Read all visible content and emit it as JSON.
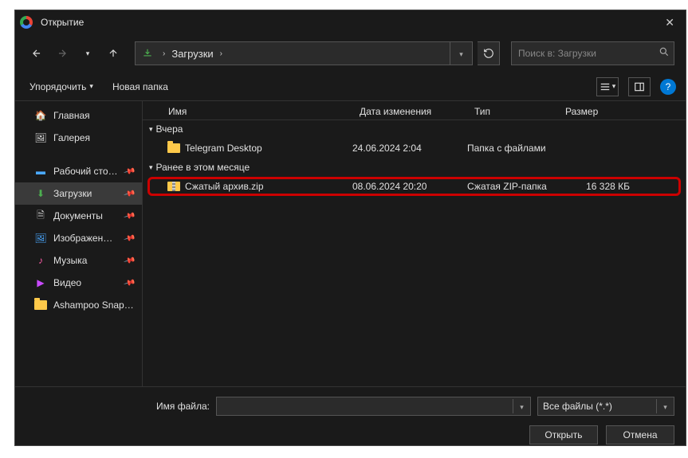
{
  "title": "Открытие",
  "path": {
    "crumb": "Загрузки"
  },
  "search": {
    "placeholder": "Поиск в: Загрузки"
  },
  "toolbar": {
    "organize": "Упорядочить",
    "newfolder": "Новая папка"
  },
  "sidebar": {
    "home": "Главная",
    "gallery": "Галерея",
    "desktop": "Рабочий сто…",
    "downloads": "Загрузки",
    "documents": "Документы",
    "pictures": "Изображен…",
    "music": "Музыка",
    "videos": "Видео",
    "ashampoo": "Ashampoo Snap…"
  },
  "columns": {
    "name": "Имя",
    "date": "Дата изменения",
    "type": "Тип",
    "size": "Размер"
  },
  "groups": {
    "yesterday": "Вчера",
    "earlier": "Ранее в этом месяце"
  },
  "files": {
    "telegram": {
      "name": "Telegram Desktop",
      "date": "24.06.2024 2:04",
      "type": "Папка с файлами",
      "size": ""
    },
    "zip": {
      "name": "Сжатый архив.zip",
      "date": "08.06.2024 20:20",
      "type": "Сжатая ZIP-папка",
      "size": "16 328 КБ"
    }
  },
  "footer": {
    "filename_label": "Имя файла:",
    "filename_value": "",
    "filter": "Все файлы (*.*)",
    "open": "Открыть",
    "cancel": "Отмена"
  }
}
